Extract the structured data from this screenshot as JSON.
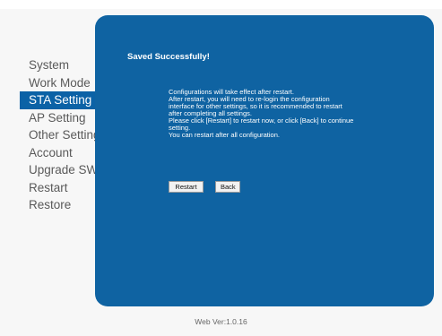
{
  "sidebar": {
    "items": [
      {
        "label": "System"
      },
      {
        "label": "Work Mode"
      },
      {
        "label": "STA Setting"
      },
      {
        "label": "AP Setting"
      },
      {
        "label": "Other Setting"
      },
      {
        "label": "Account"
      },
      {
        "label": "Upgrade SW"
      },
      {
        "label": "Restart"
      },
      {
        "label": "Restore"
      }
    ],
    "active_index": 2
  },
  "main": {
    "title": "Saved Successfully!",
    "message_lines": [
      "Configurations will take effect after restart.",
      "After restart, you will need to re-login the configuration",
      "interface for other settings, so it is recommended to restart",
      "after completing all settings.",
      "Please click [Restart] to restart now, or click [Back] to continue",
      "setting.",
      "You can restart after all configuration."
    ],
    "buttons": {
      "restart_label": "Restart",
      "back_label": "Back"
    }
  },
  "footer": {
    "version": "Web Ver:1.0.16"
  },
  "colors": {
    "panel_bg": "#0f63a2",
    "active_nav_bg": "#0b62a6",
    "nav_text": "#5a5a5a",
    "page_bg": "#f7f7f7"
  }
}
